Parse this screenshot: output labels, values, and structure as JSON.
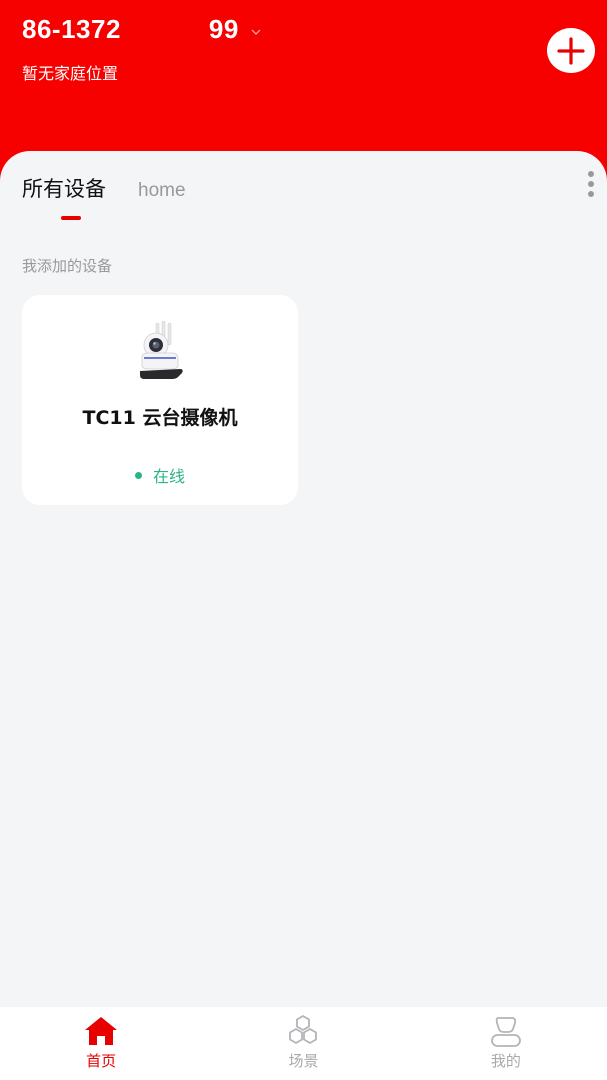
{
  "header": {
    "account_prefix": "86-1372",
    "account_suffix": "99",
    "location": "暂无家庭位置",
    "add_icon": "plus-icon",
    "background_color": "#f60000"
  },
  "tabs": [
    {
      "label": "所有设备",
      "active": true
    },
    {
      "label": "home",
      "active": false
    }
  ],
  "section": {
    "label": "我添加的设备"
  },
  "devices": [
    {
      "name": "TC11 云台摄像机",
      "status": "在线",
      "status_color": "#2bb38a",
      "icon": "camera-icon"
    }
  ],
  "bottom_nav": [
    {
      "label": "首页",
      "icon": "home-icon",
      "active": true
    },
    {
      "label": "场景",
      "icon": "scene-icon",
      "active": false
    },
    {
      "label": "我的",
      "icon": "profile-icon",
      "active": false
    }
  ],
  "accent_color": "#e60000"
}
